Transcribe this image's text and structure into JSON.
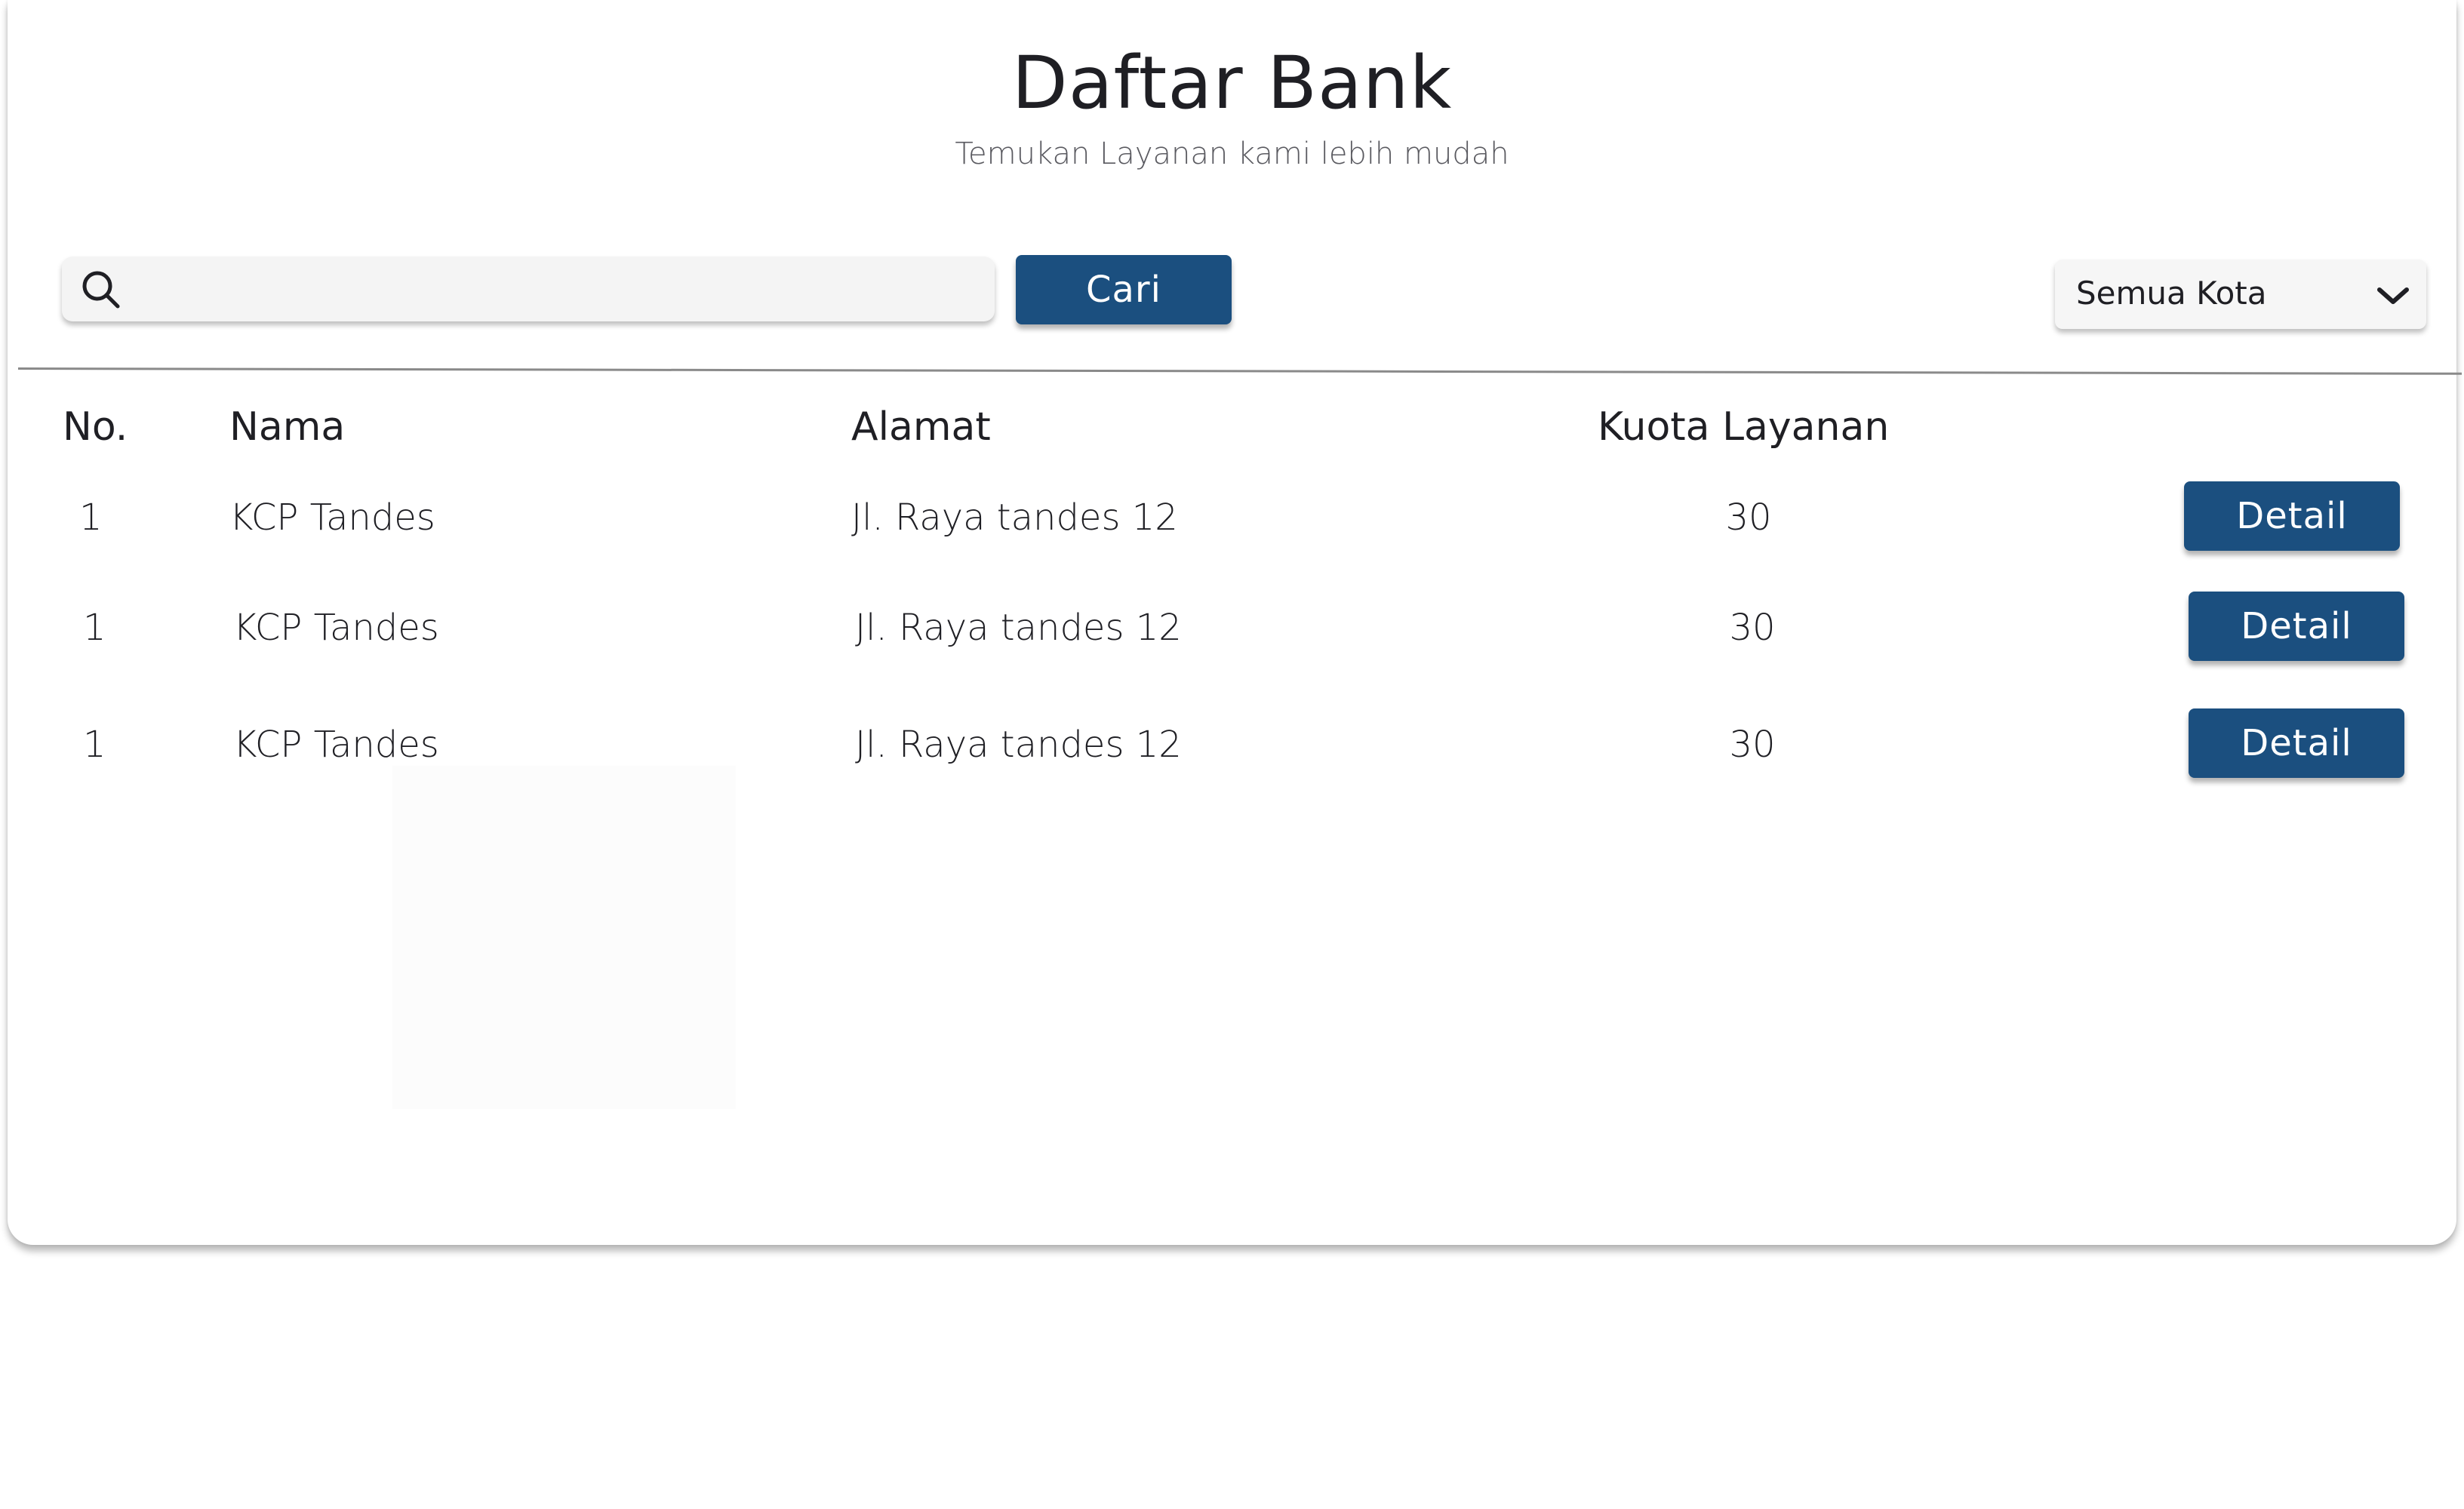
{
  "header": {
    "title": "Daftar Bank",
    "subtitle": "Temukan Layanan kami lebih mudah"
  },
  "search": {
    "icon": "search-icon",
    "value": "",
    "placeholder": "",
    "button_label": "Cari"
  },
  "filter": {
    "selected": "Semua Kota",
    "icon": "chevron-down-icon"
  },
  "table": {
    "headers": {
      "no": "No.",
      "nama": "Nama",
      "alamat": "Alamat",
      "kuota": "Kuota Layanan"
    },
    "rows": [
      {
        "no": "1",
        "nama": "KCP Tandes",
        "alamat": "Jl. Raya tandes 12",
        "kuota": "30",
        "action": "Detail"
      },
      {
        "no": "1",
        "nama": "KCP Tandes",
        "alamat": "Jl. Raya tandes 12",
        "kuota": "30",
        "action": "Detail"
      },
      {
        "no": "1",
        "nama": "KCP Tandes",
        "alamat": "Jl. Raya tandes 12",
        "kuota": "30",
        "action": "Detail"
      }
    ]
  },
  "colors": {
    "primary_button": "#1b4f7f",
    "text": "#1f1f24",
    "subtitle_text": "#5a5a60",
    "input_background": "#f4f4f4"
  }
}
